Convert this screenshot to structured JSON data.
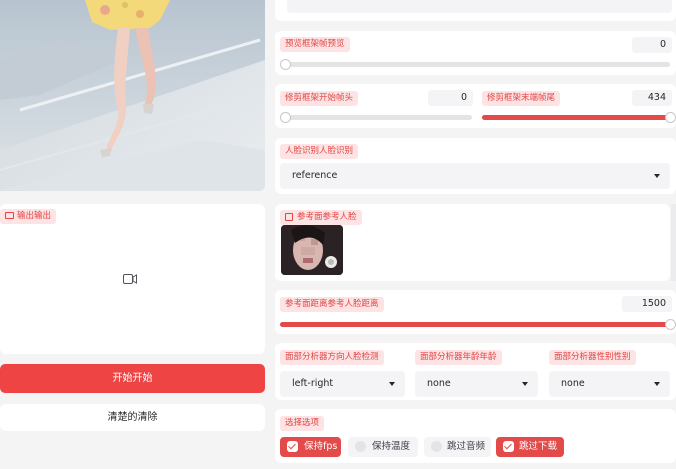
{
  "preview_image_alt": "",
  "output": {
    "label": "输出输出"
  },
  "buttons": {
    "start": "开始开始",
    "clear": "清楚的清除"
  },
  "sliders": {
    "preview_frame": {
      "label": "预览框架帧预览",
      "value": "0",
      "fraction": 0.0
    },
    "trim_start": {
      "label": "修剪框架开始帧头",
      "value": "0",
      "fraction": 0.0
    },
    "trim_end": {
      "label": "修剪框架末端帧尾",
      "value": "434",
      "fraction": 1.0
    },
    "face_distance": {
      "label": "参考面距离参考人脸距离",
      "value": "1500",
      "fraction": 1.0
    }
  },
  "face_recognition": {
    "label": "人脸识别人脸识别",
    "value": "reference"
  },
  "reference_face": {
    "label": "参考面参考人脸"
  },
  "analysis": {
    "direction": {
      "label": "面部分析器方向人脸检测",
      "value": "left-right"
    },
    "age": {
      "label": "面部分析器年龄年龄",
      "value": "none"
    },
    "gender": {
      "label": "面部分析器性别性别",
      "value": "none"
    }
  },
  "options": {
    "label": "选择选项",
    "items": [
      {
        "label": "保持fps",
        "checked": true
      },
      {
        "label": "保持温度",
        "checked": false
      },
      {
        "label": "跳过音频",
        "checked": false
      },
      {
        "label": "跳过下载",
        "checked": true
      }
    ]
  },
  "colors": {
    "accent": "#e34a4a",
    "chip_bg": "#fde3e3"
  }
}
